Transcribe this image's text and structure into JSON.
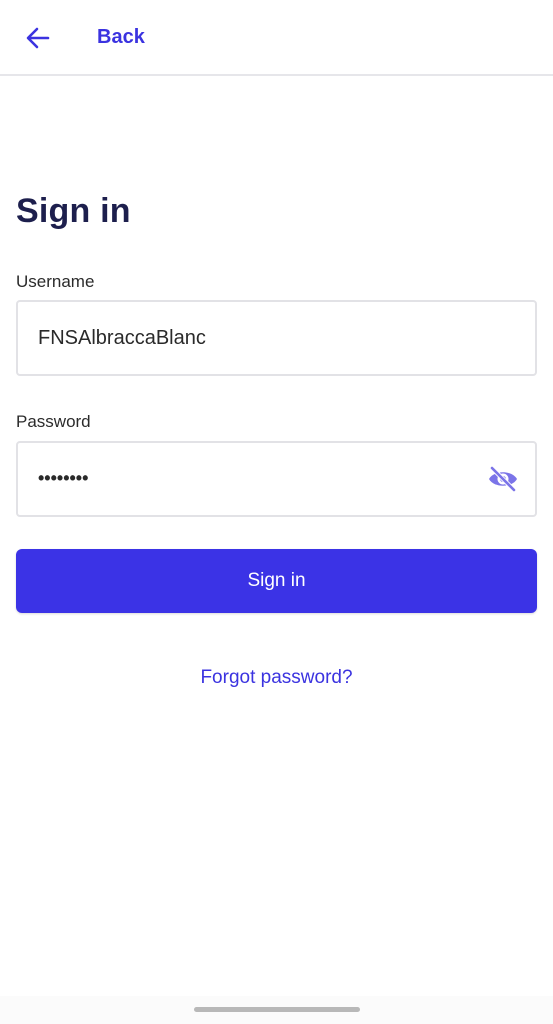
{
  "header": {
    "back_label": "Back",
    "back_icon": "arrow-left-icon"
  },
  "title": "Sign in",
  "username": {
    "label": "Username",
    "value": "FNSAlbraccaBlanc"
  },
  "password": {
    "label": "Password",
    "masked_value": "••••••••",
    "toggle_icon": "eye-off-icon"
  },
  "signin_button": {
    "label": "Sign in"
  },
  "forgot_password": {
    "label": "Forgot password?"
  },
  "colors": {
    "accent": "#3b33e6",
    "title": "#1d1f4d",
    "link": "#3b33e0"
  }
}
